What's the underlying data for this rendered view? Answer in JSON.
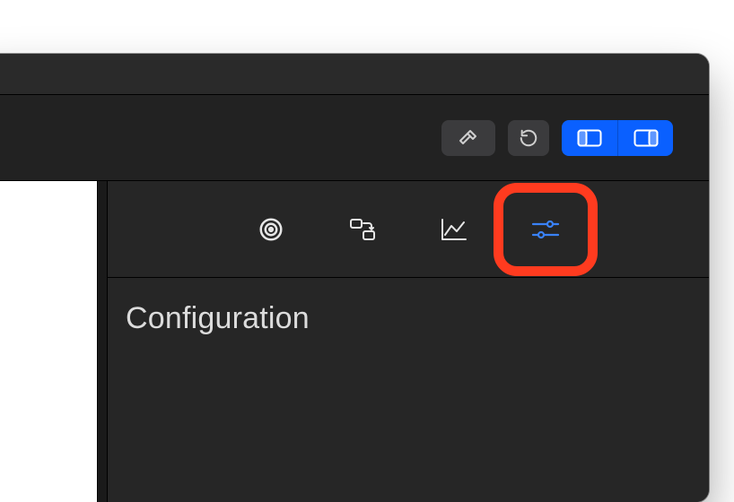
{
  "toolbar": {
    "build_label": "Build",
    "refresh_label": "Refresh",
    "panel_left_label": "Toggle Left Panel",
    "panel_right_label": "Toggle Right Panel"
  },
  "inspector": {
    "tabs": {
      "target": "Target",
      "connections": "Connections",
      "metrics": "Metrics",
      "configuration": "Configuration"
    },
    "section_title": "Configuration"
  },
  "highlight": {
    "target_tab": "configuration"
  }
}
